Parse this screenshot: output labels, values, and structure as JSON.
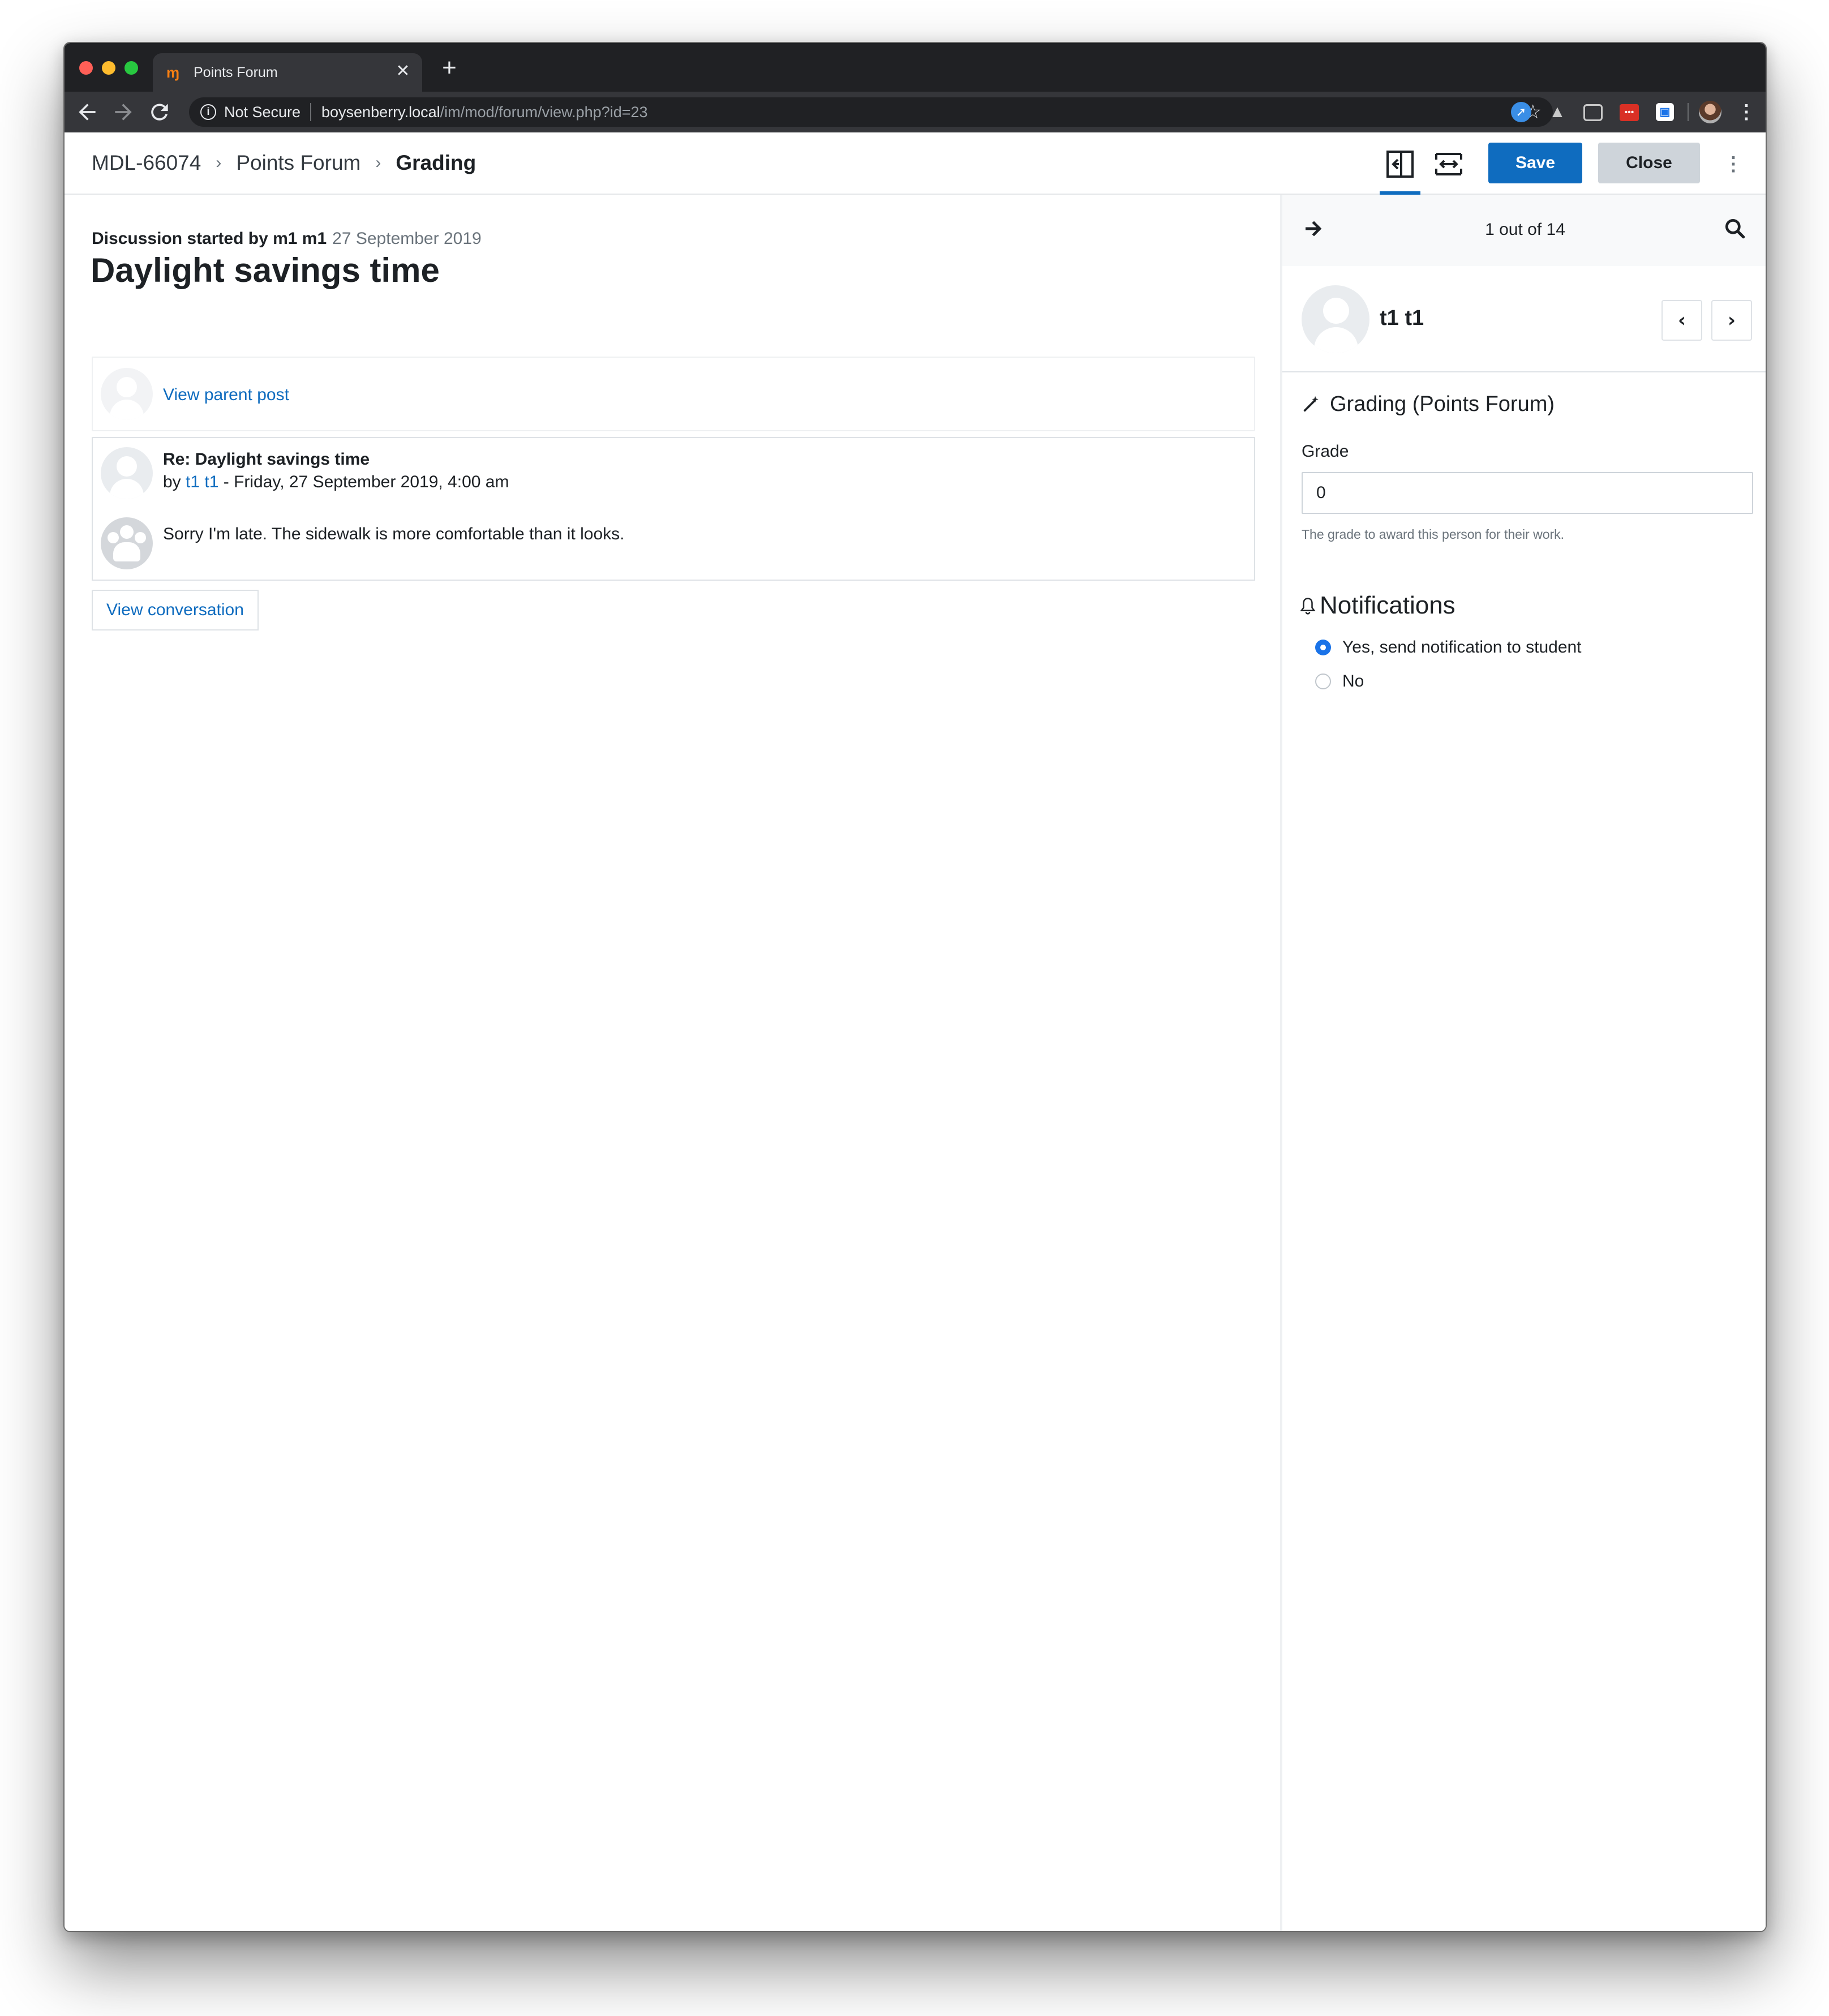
{
  "browser": {
    "tab_title": "Points Forum",
    "tab_favicon": "moodle-icon",
    "tab_close_glyph": "✕",
    "new_tab_glyph": "+",
    "security_label": "Not Secure",
    "url_host": "boysenberry.local",
    "url_path": "/im/mod/forum/view.php?id=23"
  },
  "header": {
    "breadcrumbs": [
      "MDL-66074",
      "Points Forum",
      "Grading"
    ],
    "save_label": "Save",
    "close_label": "Close"
  },
  "discussion": {
    "started_by_label": "Discussion started by m1 m1",
    "started_date": "27 September 2019",
    "title": "Daylight savings time",
    "parent_link": "View parent post",
    "post": {
      "subject": "Re: Daylight savings time",
      "by_prefix": "by",
      "author": "t1 t1",
      "date_suffix": " - Friday, 27 September 2019, 4:00 am",
      "body": "Sorry I'm late. The sidewalk is more comfortable than it looks."
    },
    "view_conversation_label": "View conversation"
  },
  "grading_panel": {
    "counter": "1 out of 14",
    "user_name": "t1 t1",
    "grading_heading": "Grading (Points Forum)",
    "grade_label": "Grade",
    "grade_value": "0",
    "grade_help": "The grade to award this person for their work.",
    "notifications_heading": "Notifications",
    "options": [
      {
        "label": "Yes, send notification to student",
        "checked": true
      },
      {
        "label": "No",
        "checked": false
      }
    ]
  },
  "colors": {
    "primary": "#0f6cbf",
    "secondary_button": "#ced4da",
    "radio_checked": "#1a73e8"
  }
}
